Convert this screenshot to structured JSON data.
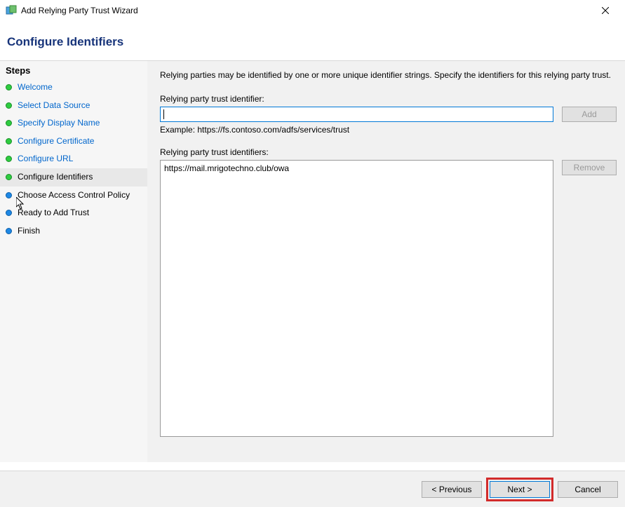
{
  "window": {
    "title": "Add Relying Party Trust Wizard"
  },
  "header": {
    "title": "Configure Identifiers"
  },
  "sidebar": {
    "title": "Steps",
    "items": [
      {
        "label": "Welcome",
        "state": "done"
      },
      {
        "label": "Select Data Source",
        "state": "done"
      },
      {
        "label": "Specify Display Name",
        "state": "done"
      },
      {
        "label": "Configure Certificate",
        "state": "done"
      },
      {
        "label": "Configure URL",
        "state": "done"
      },
      {
        "label": "Configure Identifiers",
        "state": "current"
      },
      {
        "label": "Choose Access Control Policy",
        "state": "pending"
      },
      {
        "label": "Ready to Add Trust",
        "state": "pending"
      },
      {
        "label": "Finish",
        "state": "pending"
      }
    ]
  },
  "main": {
    "description": "Relying parties may be identified by one or more unique identifier strings. Specify the identifiers for this relying party trust.",
    "identifier_label": "Relying party trust identifier:",
    "identifier_value": "",
    "add_label": "Add",
    "example_text": "Example: https://fs.contoso.com/adfs/services/trust",
    "identifiers_label": "Relying party trust identifiers:",
    "identifiers": [
      "https://mail.mrigotechno.club/owa"
    ],
    "remove_label": "Remove"
  },
  "footer": {
    "previous": "< Previous",
    "next": "Next >",
    "cancel": "Cancel"
  }
}
